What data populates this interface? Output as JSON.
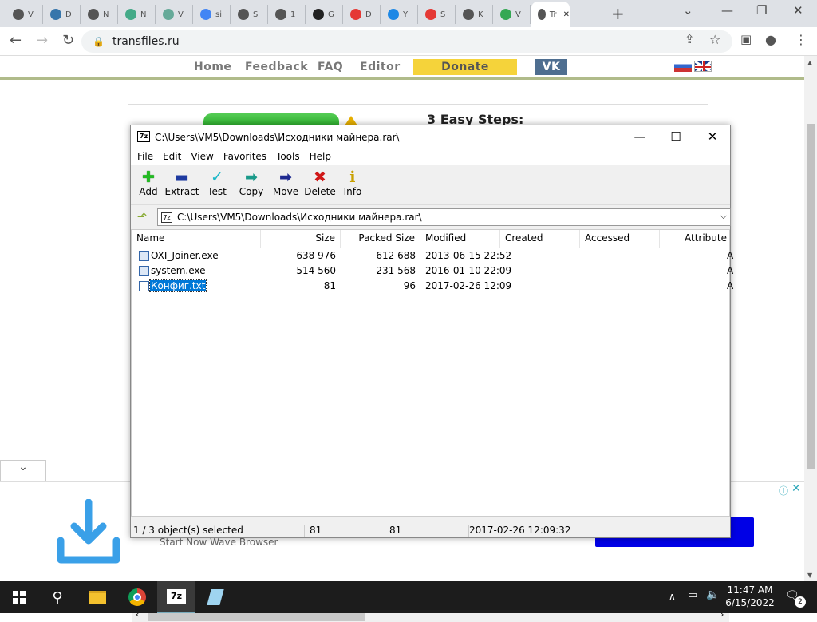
{
  "browser": {
    "tabs": [
      {
        "letter": "V",
        "color": "#555555"
      },
      {
        "letter": "D",
        "color": "#3776ab"
      },
      {
        "letter": "N",
        "color": "#555555"
      },
      {
        "letter": "N",
        "color": "#4a8"
      },
      {
        "letter": "V",
        "color": "#6a9"
      },
      {
        "letter": "si",
        "color": "#4285f4"
      },
      {
        "letter": "S",
        "color": "#555555"
      },
      {
        "letter": "1",
        "color": "#555555"
      },
      {
        "letter": "G",
        "color": "#222222"
      },
      {
        "letter": "D",
        "color": "#e53935"
      },
      {
        "letter": "Y",
        "color": "#1e88e5"
      },
      {
        "letter": "S",
        "color": "#e53935"
      },
      {
        "letter": "K",
        "color": "#555555"
      },
      {
        "letter": "V",
        "color": "#34a853"
      },
      {
        "letter": "Tr",
        "color": "#555555"
      }
    ],
    "url": "transfiles.ru"
  },
  "site": {
    "menu": [
      "Home",
      "Feedback",
      "FAQ",
      "Editor"
    ],
    "donate": "Donate",
    "vk": "VK",
    "steps_heading": "3 Easy Steps:",
    "ad_text": "Start Now Wave Browser"
  },
  "zip": {
    "title": "C:\\Users\\VM5\\Downloads\\Исходники майнера.rar\\",
    "menu": [
      "File",
      "Edit",
      "View",
      "Favorites",
      "Tools",
      "Help"
    ],
    "toolbar": [
      {
        "label": "Add",
        "icon": "add-icon"
      },
      {
        "label": "Extract",
        "icon": "extract-icon"
      },
      {
        "label": "Test",
        "icon": "test-icon"
      },
      {
        "label": "Copy",
        "icon": "copy-icon"
      },
      {
        "label": "Move",
        "icon": "move-icon"
      },
      {
        "label": "Delete",
        "icon": "delete-icon"
      },
      {
        "label": "Info",
        "icon": "info-icon"
      }
    ],
    "path": "C:\\Users\\VM5\\Downloads\\Исходники майнера.rar\\",
    "columns": [
      "Name",
      "Size",
      "Packed Size",
      "Modified",
      "Created",
      "Accessed",
      "Attribute"
    ],
    "files": [
      {
        "name": "OXI_Joiner.exe",
        "size": "638 976",
        "packed": "612 688",
        "modified": "2013-06-15 22:52",
        "attr": "A"
      },
      {
        "name": "system.exe",
        "size": "514 560",
        "packed": "231 568",
        "modified": "2016-01-10 22:09",
        "attr": "A"
      },
      {
        "name": "Конфиг.txt",
        "size": "81",
        "packed": "96",
        "modified": "2017-02-26 12:09",
        "attr": "A"
      }
    ],
    "status": {
      "selected": "1 / 3 object(s) selected",
      "size": "81",
      "packed": "81",
      "modified": "2017-02-26 12:09:32"
    }
  },
  "taskbar": {
    "time": "11:47 AM",
    "date": "6/15/2022",
    "notifications": "2"
  }
}
